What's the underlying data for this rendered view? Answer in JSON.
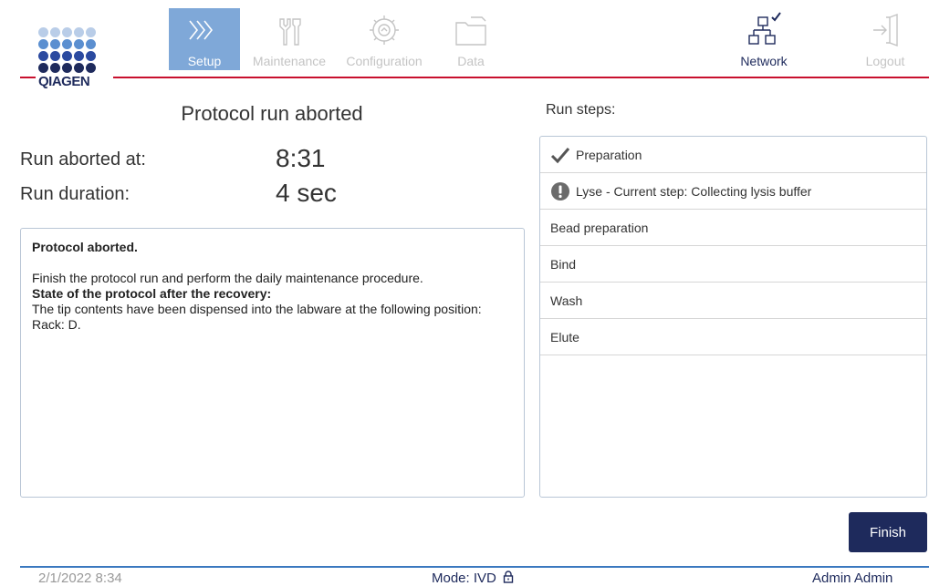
{
  "brand": {
    "logo_text": "QIAGEN",
    "dot_rows": [
      "#b9cde8",
      "#5b8fd0",
      "#2b4aa0",
      "#1e2a5c"
    ],
    "accent_red": "#c8102e",
    "navy": "#1e2a5c"
  },
  "nav": {
    "setup": {
      "label": "Setup",
      "icon": "setup-chevrons-icon",
      "active": true
    },
    "maintenance": {
      "label": "Maintenance",
      "icon": "tools-icon"
    },
    "configuration": {
      "label": "Configuration",
      "icon": "gear-icon"
    },
    "data": {
      "label": "Data",
      "icon": "folder-icon"
    },
    "network": {
      "label": "Network",
      "icon": "network-connected-icon"
    },
    "logout": {
      "label": "Logout",
      "icon": "logout-icon"
    }
  },
  "run": {
    "title": "Protocol run aborted",
    "aborted_at_label": "Run aborted at:",
    "aborted_at_value": "8:31",
    "duration_label": "Run duration:",
    "duration_value": "4 sec"
  },
  "message": {
    "heading": "Protocol aborted.",
    "line1": "Finish the protocol run and perform the daily maintenance procedure.",
    "state_heading": "State of the protocol after the recovery:",
    "line2": "The tip contents have been dispensed into the labware at the following position: Rack: D."
  },
  "steps": {
    "title": "Run steps:",
    "items": [
      {
        "label": "Preparation",
        "status": "done",
        "icon": "checkmark-icon"
      },
      {
        "label": "Lyse - Current step: Collecting lysis buffer",
        "status": "current",
        "icon": "exclamation-icon"
      },
      {
        "label": "Bead preparation",
        "status": "pending"
      },
      {
        "label": "Bind",
        "status": "pending"
      },
      {
        "label": "Wash",
        "status": "pending"
      },
      {
        "label": "Elute",
        "status": "pending"
      }
    ]
  },
  "actions": {
    "finish_label": "Finish"
  },
  "footer": {
    "datetime": "2/1/2022 8:34",
    "mode": "Mode: IVD",
    "user": "Admin Admin"
  }
}
